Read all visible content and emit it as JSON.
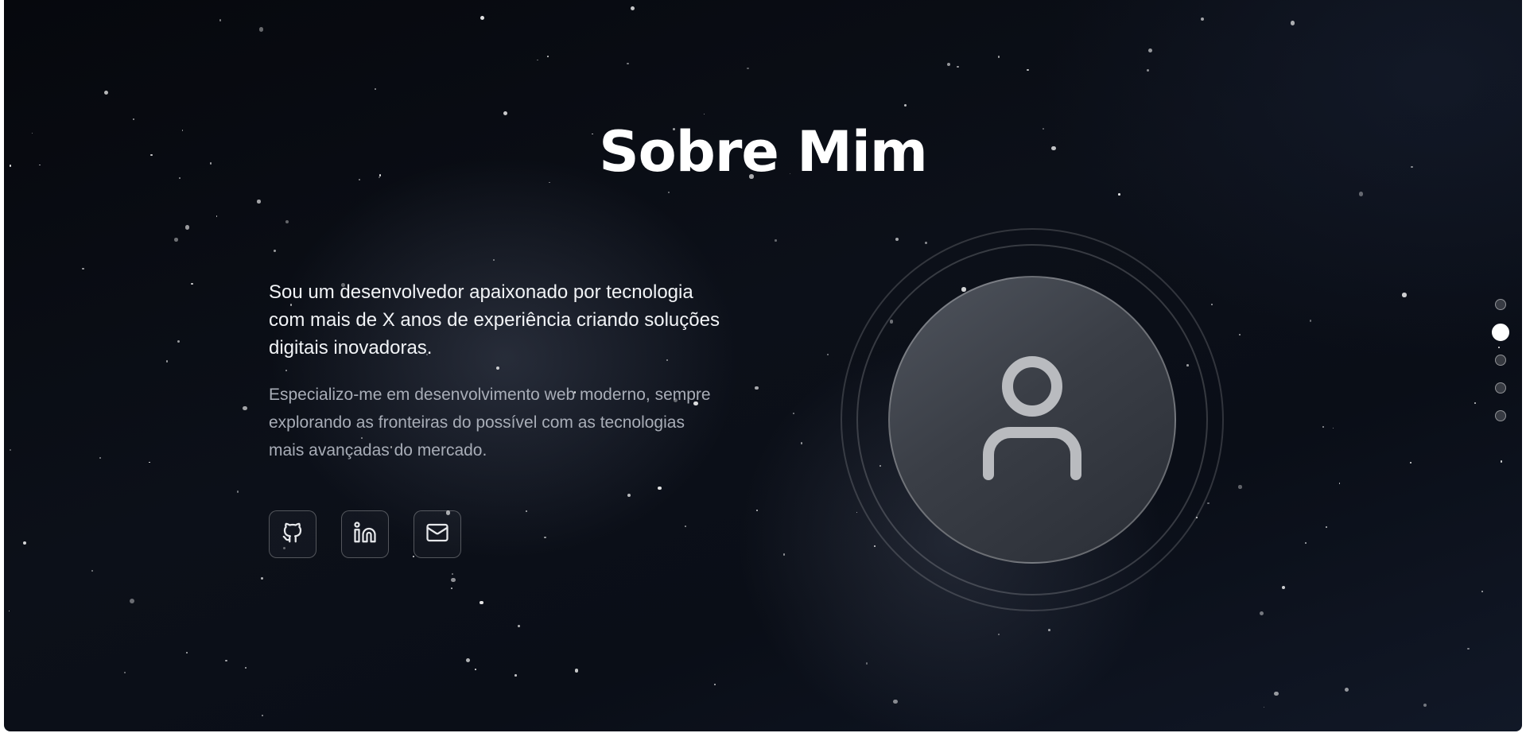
{
  "section": {
    "title": "Sobre Mim"
  },
  "about": {
    "lead": "Sou um desenvolvedor apaixonado por tecnologia com mais de X anos de experiência criando soluções digitais inovadoras.",
    "sub": "Especializo-me em desenvolvimento web moderno, sempre explorando as fronteiras do possível com as tecnologias mais avançadas do mercado."
  },
  "socials": [
    {
      "icon": "github-icon"
    },
    {
      "icon": "linkedin-icon"
    },
    {
      "icon": "mail-icon"
    }
  ],
  "avatar": {
    "icon": "user-icon"
  },
  "section_nav": {
    "count": 5,
    "active_index": 1
  },
  "colors": {
    "background": "#0a0e17",
    "text_primary": "#ffffff",
    "text_secondary": "#a8adb7",
    "icon": "#d4d6da"
  }
}
